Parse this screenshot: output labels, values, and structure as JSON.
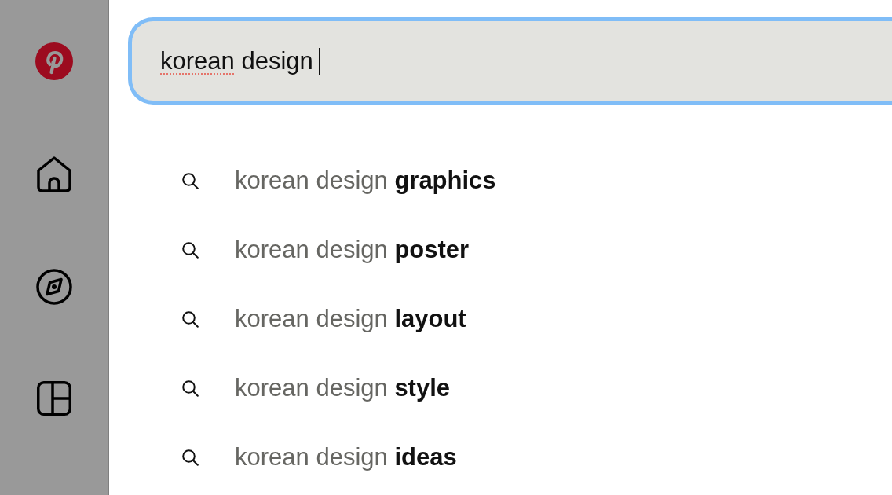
{
  "search": {
    "query": [
      {
        "word": "korean",
        "misspelled": true
      },
      {
        "word": "design",
        "misspelled": false
      }
    ],
    "focused": true
  },
  "suggestions": [
    "korean design **graphics**",
    "korean design **poster**",
    "korean design **layout**",
    "korean design **style**",
    "korean design **ideas**"
  ]
}
